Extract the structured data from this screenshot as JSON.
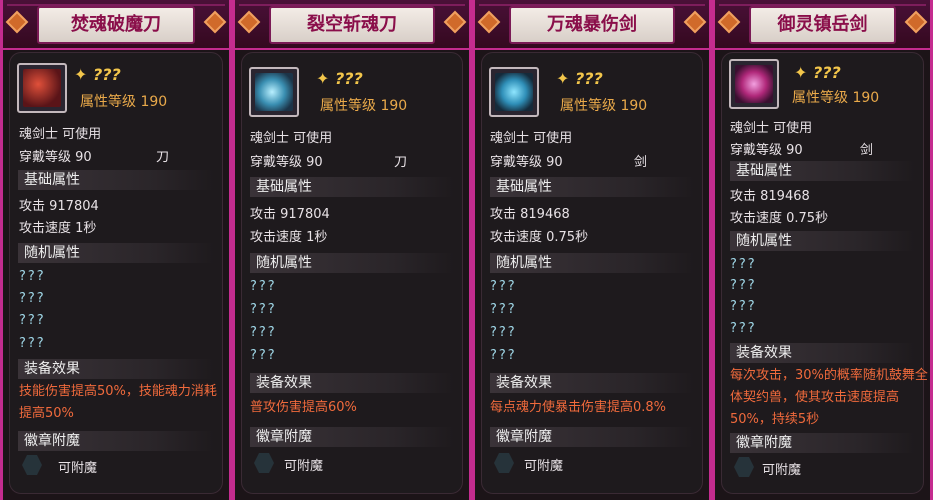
{
  "cards": [
    {
      "title": "焚魂破魔刀",
      "name": "???",
      "level": "属性等级 190",
      "class_req": "魂剑士 可使用",
      "wear_level": "穿戴等级 90",
      "weapon_type": "刀",
      "base_header": "基础属性",
      "attack": "攻击  917804",
      "speed": "攻击速度  1秒",
      "random_header": "随机属性",
      "random": [
        "???",
        "???",
        "???",
        "???"
      ],
      "effect_header": "装备效果",
      "effect": "技能伤害提高50%，技能魂力消耗提高50%",
      "badge_header": "徽章附魔",
      "enchant": "可附魔",
      "icon_color": "#a0232e"
    },
    {
      "title": "裂空斩魂刀",
      "name": "???",
      "level": "属性等级 190",
      "class_req": "魂剑士 可使用",
      "wear_level": "穿戴等级 90",
      "weapon_type": "刀",
      "base_header": "基础属性",
      "attack": "攻击  917804",
      "speed": "攻击速度  1秒",
      "random_header": "随机属性",
      "random": [
        "???",
        "???",
        "???",
        "???"
      ],
      "effect_header": "装备效果",
      "effect": "普攻伤害提高60%",
      "badge_header": "徽章附魔",
      "enchant": "可附魔",
      "icon_color": "#4fb6d8"
    },
    {
      "title": "万魂暴伤剑",
      "name": "???",
      "level": "属性等级 190",
      "class_req": "魂剑士 可使用",
      "wear_level": "穿戴等级 90",
      "weapon_type": "剑",
      "base_header": "基础属性",
      "attack": "攻击  819468",
      "speed": "攻击速度  0.75秒",
      "random_header": "随机属性",
      "random": [
        "???",
        "???",
        "???",
        "???"
      ],
      "effect_header": "装备效果",
      "effect": "每点魂力使暴击伤害提高0.8%",
      "badge_header": "徽章附魔",
      "enchant": "可附魔",
      "icon_color": "#2f8fb8"
    },
    {
      "title": "御灵镇岳剑",
      "name": "???",
      "level": "属性等级 190",
      "class_req": "魂剑士 可使用",
      "wear_level": "穿戴等级 90",
      "weapon_type": "剑",
      "base_header": "基础属性",
      "attack": "攻击  819468",
      "speed": "攻击速度  0.75秒",
      "random_header": "随机属性",
      "random": [
        "???",
        "???",
        "???",
        "???"
      ],
      "effect_header": "装备效果",
      "effect": "每次攻击，30%的概率随机鼓舞全体契约兽，使其攻击速度提高50%，持续5秒",
      "badge_header": "徽章附魔",
      "enchant": "可附魔",
      "icon_color": "#b0287a"
    }
  ]
}
